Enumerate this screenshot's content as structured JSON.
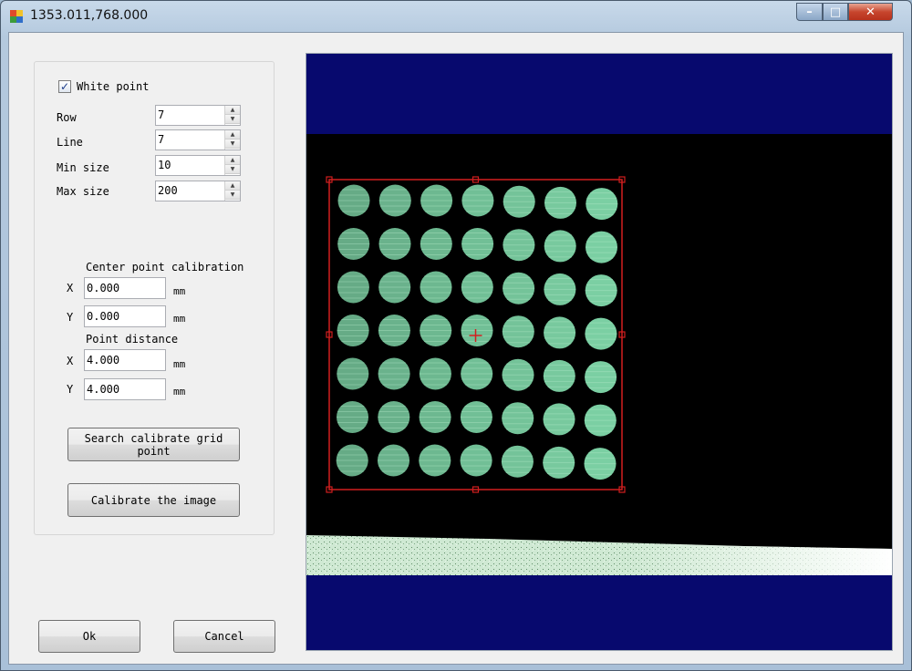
{
  "window": {
    "title": "1353.011,768.000",
    "controls": {
      "minimize": "–",
      "maximize": "□",
      "close": "✕"
    }
  },
  "settings": {
    "white_point": {
      "label": "White point",
      "checked": true
    },
    "row": {
      "label": "Row",
      "value": "7"
    },
    "line": {
      "label": "Line",
      "value": "7"
    },
    "min_size": {
      "label": "Min size",
      "value": "10"
    },
    "max_size": {
      "label": "Max size",
      "value": "200"
    }
  },
  "center_calibration": {
    "title": "Center point calibration",
    "x_label": "X",
    "x_value": "0.000",
    "x_unit": "mm",
    "y_label": "Y",
    "y_value": "0.000",
    "y_unit": "mm"
  },
  "point_distance": {
    "title": "Point distance",
    "x_label": "X",
    "x_value": "4.000",
    "x_unit": "mm",
    "y_label": "Y",
    "y_value": "4.000",
    "y_unit": "mm"
  },
  "buttons": {
    "search": "Search calibrate grid point",
    "calibrate": "Calibrate the image",
    "ok": "Ok",
    "cancel": "Cancel"
  },
  "image": {
    "grid_rows": 7,
    "grid_cols": 7,
    "colors": {
      "band": "#07096e",
      "dot": "#7fd6a8",
      "roi": "#d21f1f"
    }
  }
}
